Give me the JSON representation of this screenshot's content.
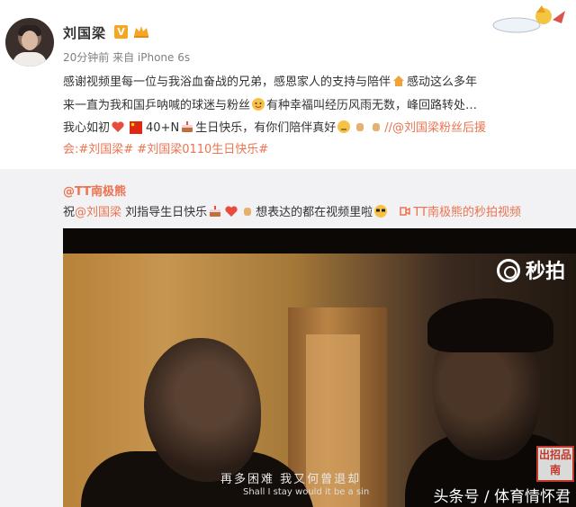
{
  "post": {
    "username": "刘国梁",
    "verified_badge": "V",
    "meta": "20分钟前 来自 iPhone 6s",
    "line1": "感谢视频里每一位与我浴血奋战的兄弟，感恩家人的支持与陪伴",
    "line1b": "感动这么多年",
    "line2": "来一直为我和国乒呐喊的球迷与粉丝",
    "line2b": "有种幸福叫经历风雨无数，峰回路转处…",
    "line3a": "我心如初",
    "line3b": "40+N",
    "line3c": "生日快乐，有你们陪伴真好",
    "line3link": "//@刘国梁粉丝后援",
    "line4": "会:#刘国梁# #刘国梁0110生日快乐#"
  },
  "repost": {
    "user": "@TT南极熊",
    "text_prefix": "祝",
    "mention": "@刘国梁",
    "text_mid": " 刘指导生日快乐",
    "text_mid2": "想表达的都在视频里啦",
    "video_link": "TT南极熊的秒拍视频"
  },
  "video": {
    "logo": "秒拍",
    "subtitle_cn": "再多困难  我又何曾退却",
    "subtitle_en": "Shall I stay   would it be a sin",
    "watermark": "头条号 / 体育情怀君",
    "stamp": "出招品南"
  },
  "icons": {
    "avatar": "avatar",
    "verified": "verified-badge-icon",
    "crown": "crown-icon",
    "heart": "heart-icon",
    "flag": "china-flag-icon",
    "cake": "cake-icon"
  },
  "colors": {
    "link": "#eb7350",
    "badge": "#f5a623",
    "background_repost": "#f2f2f5"
  }
}
